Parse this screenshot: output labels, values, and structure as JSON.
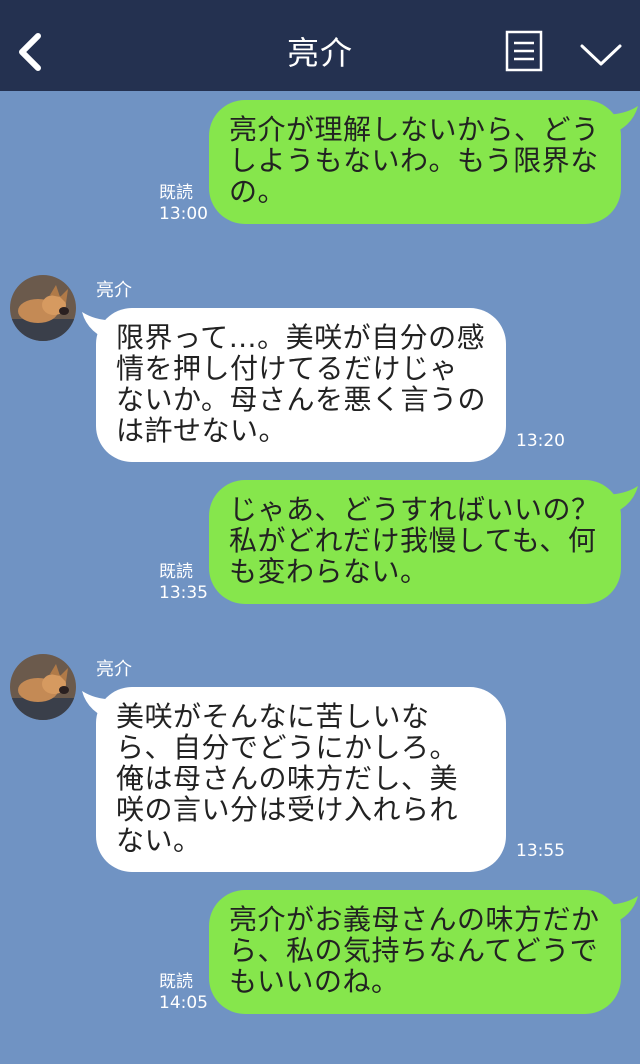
{
  "header": {
    "back_icon": "chevron-left-icon",
    "title": "亮介",
    "memo_icon": "notes-icon",
    "menu_icon": "chevron-down-icon"
  },
  "colors": {
    "header_bg": "#243150",
    "chat_bg": "#7093c3",
    "outgoing_bubble": "#86e64c",
    "incoming_bubble": "#ffffff"
  },
  "messages": [
    {
      "direction": "out",
      "text": "亮介が理解しないから、どうしようもないわ。もう限界なの。",
      "read": "既読",
      "time": "13:00"
    },
    {
      "direction": "in",
      "sender": "亮介",
      "text": "限界って…。美咲が自分の感情を押し付けてるだけじゃないか。母さんを悪く言うのは許せない。",
      "time": "13:20"
    },
    {
      "direction": "out",
      "text": "じゃあ、どうすればいいの？私がどれだけ我慢しても、何も変わらない。",
      "read": "既読",
      "time": "13:35"
    },
    {
      "direction": "in",
      "sender": "亮介",
      "text": "美咲がそんなに苦しいなら、自分でどうにかしろ。俺は母さんの味方だし、美咲の言い分は受け入れられない。",
      "time": "13:55"
    },
    {
      "direction": "out",
      "text": "亮介がお義母さんの味方だから、私の気持ちなんてどうでもいいのね。",
      "read": "既読",
      "time": "14:05"
    }
  ]
}
